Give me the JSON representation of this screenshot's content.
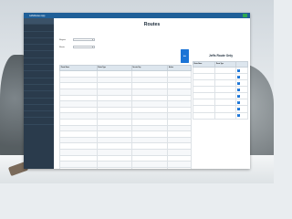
{
  "window": {
    "app_title": "JeffsRoutes App"
  },
  "sidebar": {
    "items": [
      {
        "label": ""
      },
      {
        "label": ""
      },
      {
        "label": ""
      },
      {
        "label": ""
      },
      {
        "label": ""
      },
      {
        "label": ""
      },
      {
        "label": ""
      },
      {
        "label": ""
      },
      {
        "label": ""
      },
      {
        "label": ""
      },
      {
        "label": ""
      },
      {
        "label": ""
      },
      {
        "label": ""
      },
      {
        "label": ""
      },
      {
        "label": ""
      },
      {
        "label": ""
      }
    ]
  },
  "page": {
    "title": "Routes"
  },
  "form": {
    "field1_label": "Region",
    "field1_value": "",
    "field2_label": "Route",
    "field2_value": "",
    "add_button_label": "Add"
  },
  "routes_table": {
    "headers": [
      "Route Name",
      "Route Type",
      "Service Day",
      "Action"
    ],
    "rows": [
      [
        "",
        "",
        "",
        ""
      ],
      [
        "",
        "",
        "",
        ""
      ],
      [
        "",
        "",
        "",
        ""
      ],
      [
        "",
        "",
        "",
        ""
      ],
      [
        "",
        "",
        "",
        ""
      ],
      [
        "",
        "",
        "",
        ""
      ],
      [
        "",
        "",
        "",
        ""
      ],
      [
        "",
        "",
        "",
        ""
      ],
      [
        "",
        "",
        "",
        ""
      ],
      [
        "",
        "",
        "",
        ""
      ],
      [
        "",
        "",
        "",
        ""
      ],
      [
        "",
        "",
        "",
        ""
      ],
      [
        "",
        "",
        "",
        ""
      ],
      [
        "",
        "",
        "",
        ""
      ],
      [
        "",
        "",
        "",
        ""
      ],
      [
        "",
        "",
        "",
        ""
      ],
      [
        "",
        "",
        "",
        ""
      ]
    ]
  },
  "jeffs_panel": {
    "title": "Jeffs Route Only",
    "headers": [
      "Route Name",
      "Route Type",
      ""
    ],
    "rows": [
      [
        "",
        "",
        "+"
      ],
      [
        "",
        "",
        "+"
      ],
      [
        "",
        "",
        "+"
      ],
      [
        "",
        "",
        "+"
      ],
      [
        "",
        "",
        "+"
      ],
      [
        "",
        "",
        "+"
      ],
      [
        "",
        "",
        "+"
      ],
      [
        "",
        "",
        "+"
      ]
    ]
  },
  "colors": {
    "titlebar": "#1f5f98",
    "sidebar": "#2a3b4c",
    "accent_button": "#1b74d6",
    "window_control": "#2fa84f"
  }
}
